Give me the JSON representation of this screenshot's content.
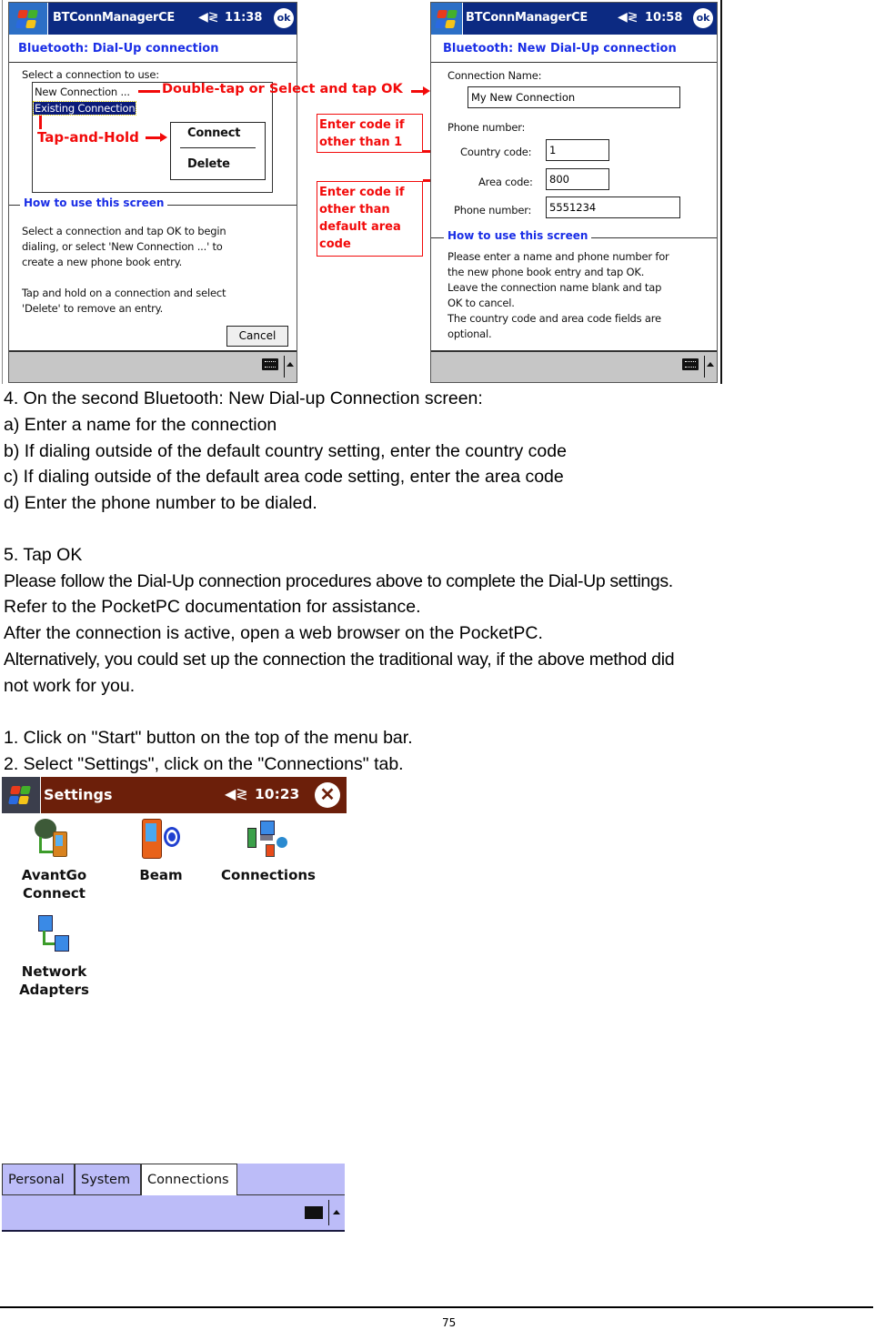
{
  "screen1": {
    "app_name": "BTConnManagerCE",
    "time": "11:38",
    "ok_label": "ok",
    "subtitle": "Bluetooth: Dial-Up connection",
    "select_label": "Select a connection to use:",
    "list_items": [
      "New Connection ...",
      "Existing Connection"
    ],
    "context_menu": [
      "Connect",
      "Delete"
    ],
    "howto_title": "How to use this screen",
    "howto_lines": [
      "Select a connection and tap OK to begin",
      "dialing, or select 'New Connection ...' to",
      "create a new phone book entry.",
      "",
      "Tap and hold on a connection and select",
      "'Delete' to remove an entry."
    ],
    "cancel_label": "Cancel"
  },
  "annotations": {
    "double_tap": "Double-tap or Select and tap OK",
    "tap_hold": "Tap-and-Hold",
    "country_note": [
      "Enter code if",
      "other than 1"
    ],
    "area_note": [
      "Enter code if",
      "other than",
      "default area",
      "code"
    ]
  },
  "screen2": {
    "app_name": "BTConnManagerCE",
    "time": "10:58",
    "ok_label": "ok",
    "subtitle": "Bluetooth: New Dial-Up connection",
    "connection_name_label": "Connection Name:",
    "connection_name_value": "My New Connection",
    "phone_number_heading": "Phone number:",
    "country_code_label": "Country code:",
    "country_code_value": "1",
    "area_code_label": "Area code:",
    "area_code_value": "800",
    "phone_label": "Phone number:",
    "phone_value": "5551234",
    "howto_title": "How to use this screen",
    "howto_lines": [
      "Please enter a name and phone number for",
      "the new phone book entry and tap OK.",
      "Leave the connection name blank and tap",
      "OK to cancel.",
      "The country code and area code fields are",
      "optional."
    ]
  },
  "document": {
    "step4": [
      "4. On the second Bluetooth: New Dial-up Connection screen:",
      "a) Enter a name for the connection",
      "b) If dialing outside of the default country setting, enter the country code",
      "c) If dialing outside of the default area code setting, enter the area code",
      "d) Enter the phone number to be dialed."
    ],
    "step5": [
      "5. Tap OK",
      "Please follow the Dial-Up connection procedures above to complete the Dial-Up settings.",
      "Refer to the PocketPC documentation for assistance.",
      "After the connection is active, open a web browser on the PocketPC.",
      "Alternatively, you could set up the connection the traditional way, if the above method did",
      "not work for you."
    ],
    "steps_alt": [
      "1. Click on \"Start\" button on the top of the menu bar.",
      "2. Select \"Settings\", click on the \"Connections\" tab."
    ],
    "page_number": "75"
  },
  "settings_screen": {
    "title": "Settings",
    "time": "10:23",
    "icons": [
      {
        "label_lines": [
          "AvantGo",
          "Connect"
        ],
        "icon": "avantgo-icon"
      },
      {
        "label_lines": [
          "Beam"
        ],
        "icon": "beam-icon"
      },
      {
        "label_lines": [
          "Connections"
        ],
        "icon": "connections-icon"
      },
      {
        "label_lines": [
          "Network",
          "Adapters"
        ],
        "icon": "network-adapters-icon"
      }
    ],
    "tabs": [
      "Personal",
      "System",
      "Connections"
    ],
    "active_tab": "Connections"
  },
  "colors": {
    "ppc_titlebar": "#0c2a82",
    "ppc_subtitle": "#1a2ee6",
    "annotation_red": "#f20a0a",
    "settings_titlebar": "#6c1f0a",
    "settings_tabbar": "#bcbcf8"
  }
}
